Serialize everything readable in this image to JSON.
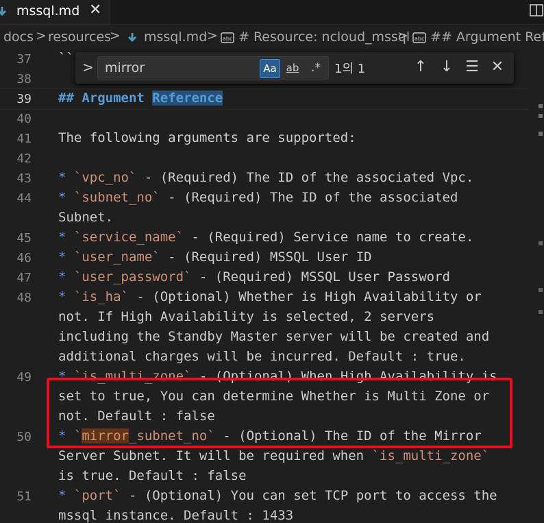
{
  "tab": {
    "label": "mssql.md",
    "close": "✕"
  },
  "breadcrumb": {
    "items": [
      "docs",
      "resources",
      "mssql.md",
      "# Resource: ncloud_mssql",
      "## Argument Refere"
    ],
    "separator": ">"
  },
  "find": {
    "toggle": ">",
    "value": "mirror",
    "match_case": "Aa",
    "whole_word": "ab",
    "regex": ".*",
    "count": "1의 1",
    "prev": "↑",
    "next": "↓",
    "selection": "☰",
    "close": "✕"
  },
  "editor": {
    "line_numbers": [
      "37",
      "38",
      "39",
      "40",
      "41",
      "42",
      "43",
      "44",
      "45",
      "46",
      "47",
      "48",
      "49",
      "50",
      "51"
    ],
    "line37": "``",
    "line39": {
      "hashes": "## ",
      "word1": "Argument",
      "space": " ",
      "word2": "Reference"
    },
    "line41": "The following arguments are supported:",
    "line43": {
      "bullet": "* ",
      "code": "`vpc_no`",
      "rest": " - (Required) The ID of the associated Vpc."
    },
    "line44a": {
      "bullet": "* ",
      "code": "`subnet_no`",
      "rest": " - (Required) The ID of the associated"
    },
    "line44b": "Subnet.",
    "line45": {
      "bullet": "* ",
      "code": "`service_name`",
      "rest": " - (Required) Service name to create."
    },
    "line46": {
      "bullet": "* ",
      "code": "`user_name`",
      "rest": " - (Required) MSSQL User ID"
    },
    "line47": {
      "bullet": "* ",
      "code": "`user_password`",
      "rest": " - (Required) MSSQL User Password"
    },
    "line48a": {
      "bullet": "* ",
      "code": "`is_ha`",
      "rest": " - (Optional) Whether is High Availability or"
    },
    "line48b": "not. If High Availability is selected, 2 servers",
    "line48c": "including the Standby Master server will be created and",
    "line48d": "additional charges will be incurred. Default : true.",
    "line49a": {
      "bullet": "* ",
      "code": "`is_multi_zone`",
      "rest": " - (Optional) When High Availability is"
    },
    "line49b": "set to true, You can determine Whether is Multi Zone or",
    "line49c": "not. Default : false",
    "line50a": {
      "bullet": "* ",
      "tick1": "`",
      "match": "mirror",
      "code_rest": "_subnet_no`",
      "rest": " - (Optional) The ID of the Mirror"
    },
    "line50b": {
      "text": "Server Subnet. It will be required when ",
      "code": "`is_multi_zone`"
    },
    "line50c": "is true. Default : false",
    "line51a": {
      "bullet": "* ",
      "code": "`port`",
      "rest": " - (Optional) You can set TCP port to access the"
    },
    "line51b": "mssql instance. Default : 1433"
  },
  "colors": {
    "annotation": "#e81123",
    "find_match": "#623315",
    "code": "#ce9178",
    "heading": "#569cd6"
  }
}
